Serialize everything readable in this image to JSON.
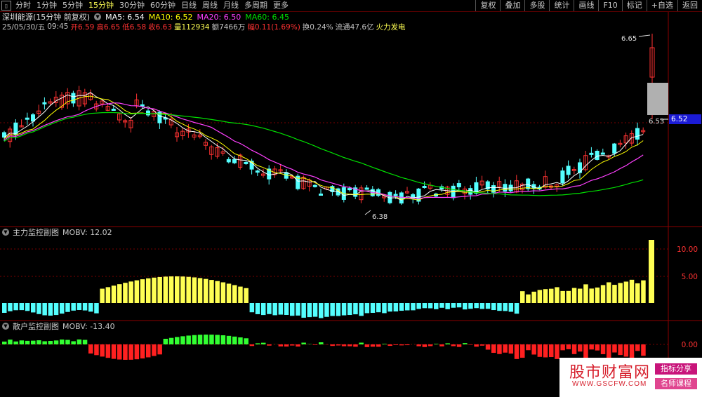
{
  "toolbar": {
    "tabs": [
      "分时",
      "1分钟",
      "5分钟",
      "15分钟",
      "30分钟",
      "60分钟",
      "日线",
      "周线",
      "月线",
      "多周期",
      "更多"
    ],
    "active_tab": "15分钟",
    "right_buttons": [
      "复权",
      "叠加",
      "多股",
      "统计",
      "画线",
      "F10",
      "标记",
      "+自选",
      "返回"
    ]
  },
  "stock": {
    "title": "深圳能源(15分钟 前复权)",
    "ma5": "MA5: 6.54",
    "ma10": "MA10: 6.52",
    "ma20": "MA20: 6.50",
    "ma60": "MA60: 6.45"
  },
  "info": {
    "date": "25/05/30/五",
    "time": "09:45",
    "open": "开6.59",
    "high": "高6.65",
    "low": "低6.58",
    "close": "收6.63",
    "volume": "量112934",
    "amount": "额7466万",
    "change": "幅0.11(1.69%)",
    "turnover": "换0.24%",
    "float": "流通47.6亿",
    "sector": "火力发电"
  },
  "annotations": {
    "high_label": "6.65",
    "low_label": "6.38",
    "cur_label": "6.53",
    "price_box": "6.52"
  },
  "panel_main_force": {
    "title": "主力监控副图",
    "value": "MOBV: 12.02",
    "ticks": [
      "10.00",
      "5.00"
    ]
  },
  "panel_retail": {
    "title": "散户监控副图",
    "value": "MOBV: -13.40",
    "ticks": [
      "0.00"
    ]
  },
  "watermark": {
    "main": "股市财富网",
    "url": "WWW.GSCFW.COM",
    "tag1": "指标分享",
    "tag2": "名师课程"
  },
  "colors": {
    "up": "#ff3232",
    "down": "#54ffff",
    "ma5": "#ffffff",
    "ma10": "#ffff00",
    "ma20": "#ff40ff",
    "ma60": "#00e000",
    "mobv_pos": "#ffff54",
    "mobv_neg": "#54ffff",
    "retail_pos": "#32ff32",
    "retail_neg": "#ff2020"
  }
}
